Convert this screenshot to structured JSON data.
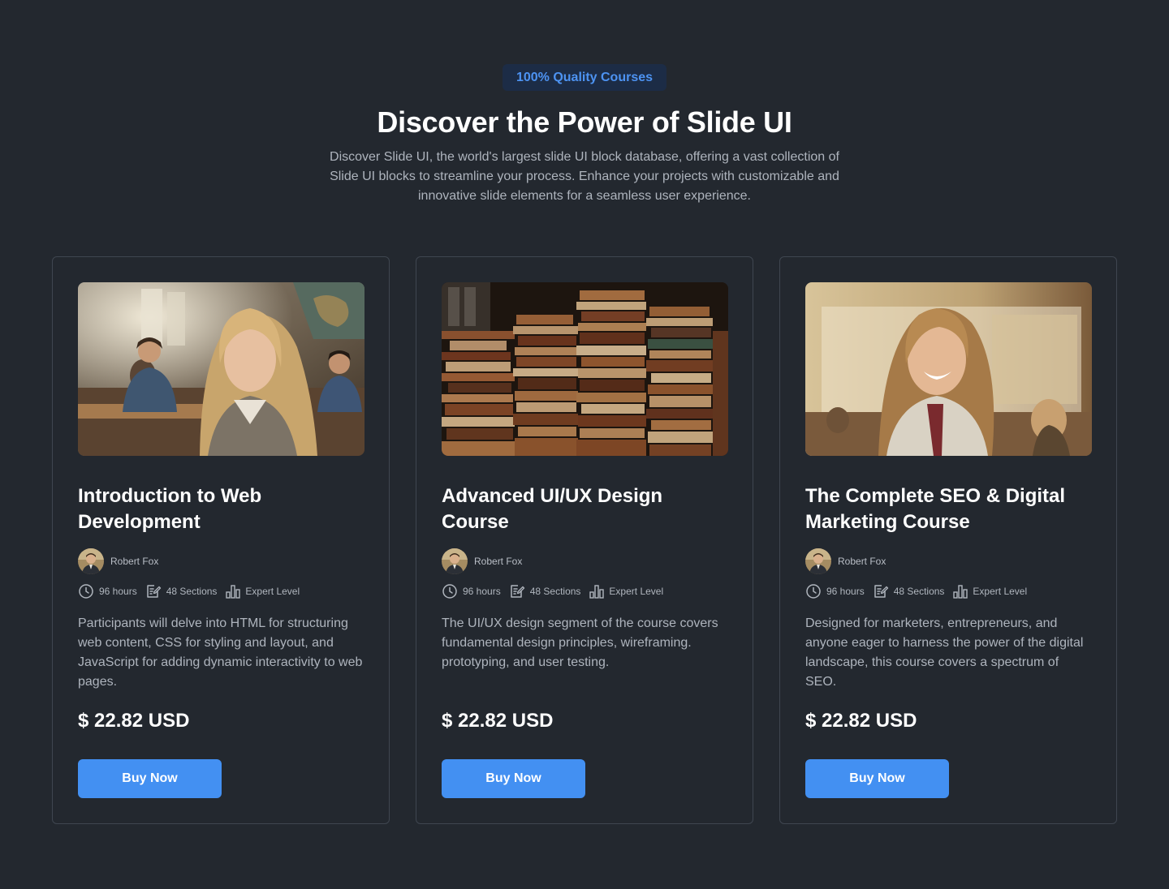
{
  "header": {
    "badge": "100% Quality Courses",
    "title": "Discover the Power of Slide UI",
    "subtitle": "Discover Slide UI, the world's largest slide UI block database, offering a vast collection of Slide UI blocks to streamline your process. Enhance your projects with customizable and innovative slide elements for a seamless user experience."
  },
  "colors": {
    "background": "#23282f",
    "accent": "#4390f2",
    "badge_bg": "#1c2c46",
    "badge_text": "#4d93f2",
    "card_border": "#3f4650"
  },
  "cards": [
    {
      "image_icon": "classroom-student-photo",
      "title": "Introduction to Web Development",
      "author": "Robert Fox",
      "hours": "96 hours",
      "sections": "48 Sections",
      "level": "Expert Level",
      "description": "Participants will delve into HTML for structuring web content, CSS for styling and layout, and JavaScript for adding dynamic interactivity to web pages.",
      "price": "$ 22.82 USD",
      "button": "Buy Now"
    },
    {
      "image_icon": "book-stacks-photo",
      "title": "Advanced UI/UX Design Course",
      "author": "Robert Fox",
      "hours": "96 hours",
      "sections": "48 Sections",
      "level": "Expert Level",
      "description": "The UI/UX design segment of the course covers fundamental design principles, wireframing. prototyping, and user testing.",
      "price": "$ 22.82 USD",
      "button": "Buy Now"
    },
    {
      "image_icon": "smiling-student-photo",
      "title": "The Complete SEO & Digital Marketing Course",
      "author": "Robert Fox",
      "hours": "96 hours",
      "sections": "48 Sections",
      "level": "Expert Level",
      "description": "Designed for marketers, entrepreneurs, and anyone eager to harness the power of the digital landscape, this course covers a spectrum of SEO.",
      "price": "$ 22.82 USD",
      "button": "Buy Now"
    }
  ]
}
